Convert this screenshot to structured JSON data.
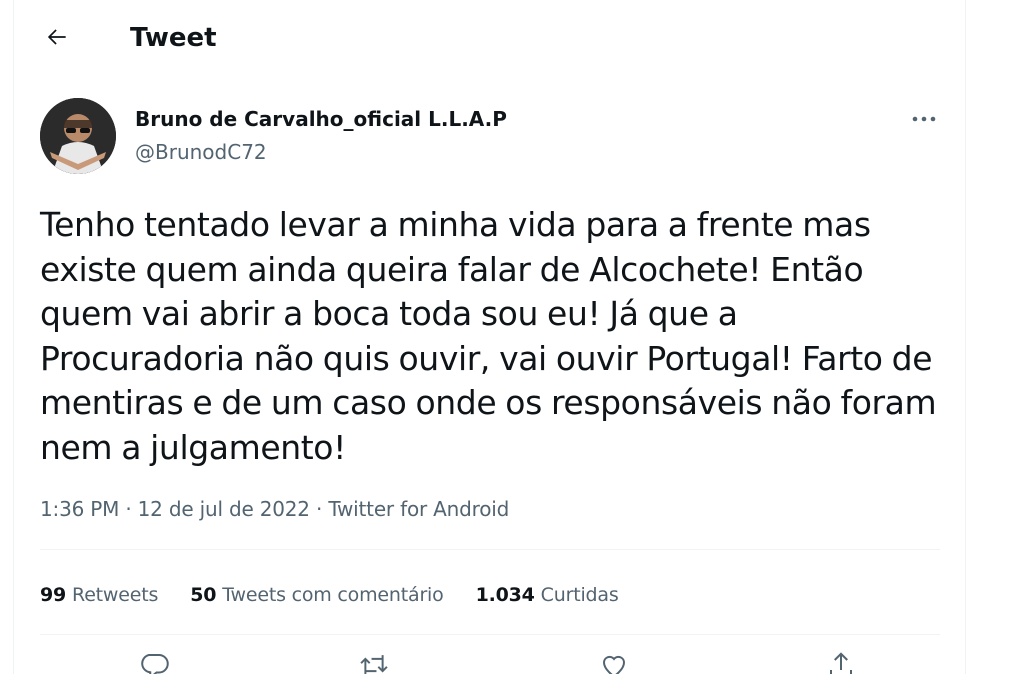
{
  "header": {
    "title": "Tweet",
    "back_icon": "arrow-left-icon"
  },
  "author": {
    "display_name": "Bruno de Carvalho_oficial L.L.A.P",
    "handle": "@BrunodC72",
    "avatar_icon": "avatar",
    "more_icon": "more-horizontal-icon"
  },
  "tweet": {
    "lines": [
      "Tenho tentado levar a minha vida para a frente mas",
      "existe quem ainda queira falar de Alcochete! Então",
      "quem vai abrir a boca toda sou eu! Já que a",
      "Procuradoria não quis ouvir, vai ouvir Portugal! Farto de",
      "mentiras e de um caso onde os responsáveis não foram",
      "nem a julgamento!"
    ],
    "timestamp": "1:36 PM · 12 de jul de 2022 · ",
    "source": "Twitter for Android"
  },
  "stats": {
    "retweets_count": "99",
    "retweets_label": "Retweets",
    "quotes_count": "50",
    "quotes_label": "Tweets com comentário",
    "likes_count": "1.034",
    "likes_label": "Curtidas"
  },
  "actions": {
    "reply_icon": "reply-icon",
    "retweet_icon": "retweet-icon",
    "like_icon": "heart-icon",
    "share_icon": "share-icon"
  },
  "colors": {
    "text_primary": "#0f1419",
    "text_secondary": "#536471",
    "divider": "#eff3f4"
  }
}
